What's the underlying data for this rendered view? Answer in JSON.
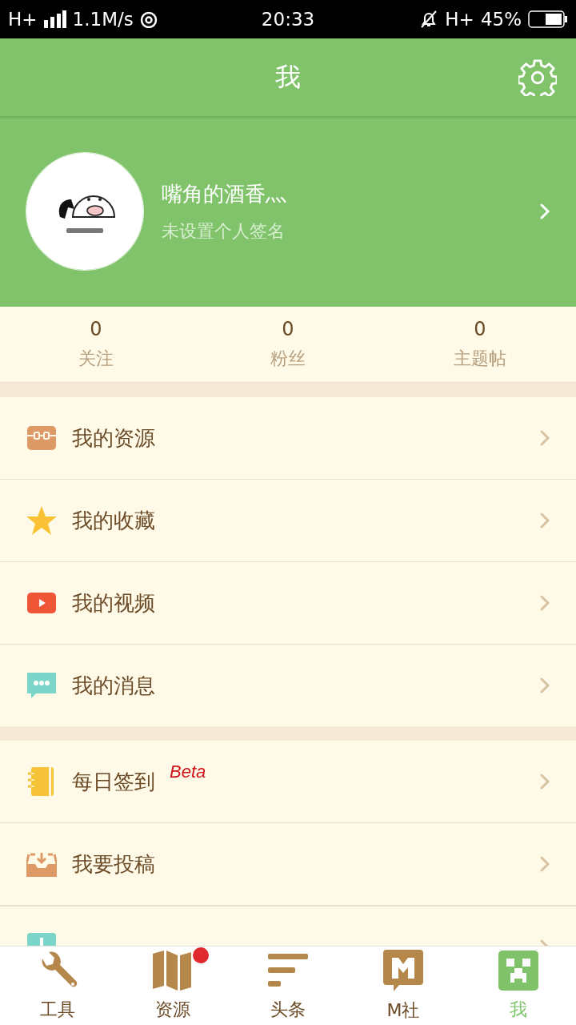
{
  "status_bar": {
    "network": "H+",
    "speed": "1.1M/s",
    "time": "20:33",
    "network_right": "H+",
    "battery": "45%"
  },
  "header": {
    "title": "我"
  },
  "profile": {
    "name": "嘴角的酒香灬",
    "signature": "未设置个人签名"
  },
  "stats": [
    {
      "value": "0",
      "label": "关注"
    },
    {
      "value": "0",
      "label": "粉丝"
    },
    {
      "value": "0",
      "label": "主题帖"
    }
  ],
  "menu_groups": [
    {
      "items": [
        {
          "label": "我的资源"
        },
        {
          "label": "我的收藏"
        },
        {
          "label": "我的视频"
        },
        {
          "label": "我的消息"
        }
      ]
    },
    {
      "items": [
        {
          "label": "每日签到",
          "tag": "Beta"
        },
        {
          "label": "我要投稿"
        }
      ]
    }
  ],
  "tabs": [
    {
      "label": "工具",
      "selected": false,
      "badge": false
    },
    {
      "label": "资源",
      "selected": false,
      "badge": true
    },
    {
      "label": "头条",
      "selected": false,
      "badge": false
    },
    {
      "label": "M社",
      "selected": false,
      "badge": false
    },
    {
      "label": "我",
      "selected": true,
      "badge": false
    }
  ]
}
